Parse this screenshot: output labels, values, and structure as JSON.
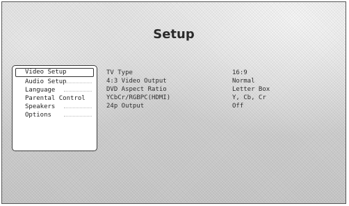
{
  "title": "Setup",
  "menu": {
    "items": [
      {
        "label": "Video Setup",
        "selected": true
      },
      {
        "label": "Audio Setup",
        "selected": false
      },
      {
        "label": "Language",
        "selected": false
      },
      {
        "label": "Parental Control",
        "selected": false
      },
      {
        "label": "Speakers",
        "selected": false
      },
      {
        "label": "Options",
        "selected": false
      }
    ]
  },
  "settings": [
    {
      "label": "TV Type",
      "value": "16:9"
    },
    {
      "label": "4:3 Video Output",
      "value": "Normal"
    },
    {
      "label": "DVD Aspect Ratio",
      "value": "Letter Box"
    },
    {
      "label": "YCbCr/RGBPC(HDMI)",
      "value": "Y, Cb, Cr"
    },
    {
      "label": "24p Output",
      "value": "Off"
    }
  ],
  "colors": {
    "background": "#d6d6d6",
    "panel": "#ffffff",
    "text": "#2a2a2a",
    "border": "#3a3a3a"
  }
}
